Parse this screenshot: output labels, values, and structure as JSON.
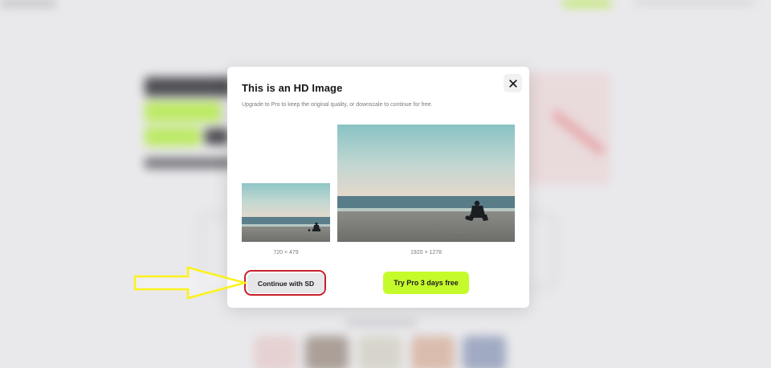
{
  "modal": {
    "title": "This is an HD Image",
    "subtitle": "Upgrade to Pro to keep the original quality, or downscale to continue for free.",
    "close_icon": "close-icon",
    "sd_preview": {
      "dimensions": "720 × 479"
    },
    "hd_preview": {
      "dimensions": "1920 × 1278"
    },
    "continue_sd_label": "Continue with SD",
    "try_pro_label": "Try Pro 3 days free"
  },
  "annotations": {
    "arrow_color": "#fbf21e",
    "highlight_ring_color": "#c8202c"
  },
  "colors": {
    "accent": "#c6fb2b",
    "backdrop": "#e9e9ec"
  }
}
